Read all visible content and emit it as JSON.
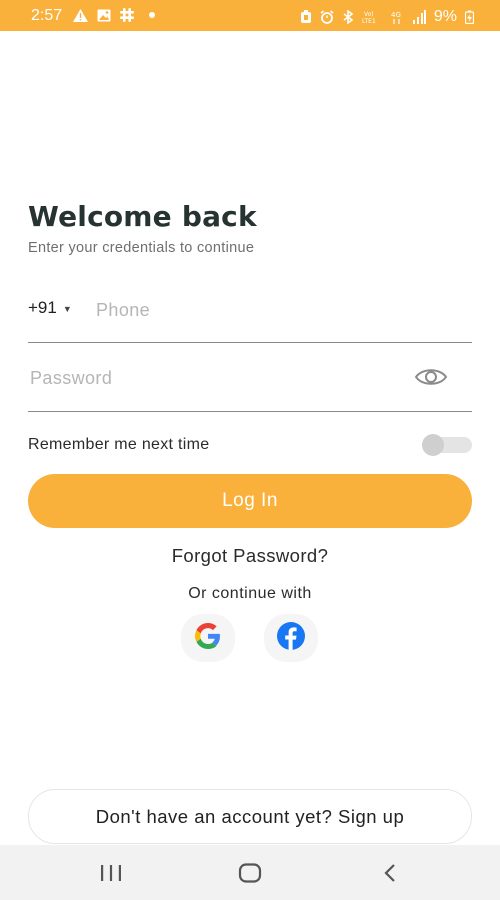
{
  "status_bar": {
    "time": "2:57",
    "battery": "9%",
    "network_label": "4G",
    "icons": [
      "warning-icon",
      "image-icon",
      "slack-icon",
      "dot-icon",
      "battery-saver-icon",
      "alarm-icon",
      "bluetooth-icon",
      "volte-icon",
      "data-icon",
      "signal-icon",
      "battery-charging-icon"
    ],
    "background": "#f9b13c"
  },
  "login": {
    "title": "Welcome back",
    "subtitle": "Enter your credentials to continue",
    "country_code": "+91",
    "phone_placeholder": "Phone",
    "password_placeholder": "Password",
    "remember_label": "Remember me next time",
    "remember_enabled": false,
    "login_button": "Log In",
    "forgot_password": "Forgot Password?",
    "continue_with": "Or continue with",
    "social": [
      "google-icon",
      "facebook-icon"
    ],
    "signup_button": "Don't have an account yet? Sign up"
  },
  "colors": {
    "accent": "#f9b13c",
    "title": "#263331",
    "facebook": "#1877f2"
  },
  "nav_bar": {
    "buttons": [
      "recents-icon",
      "home-icon",
      "back-icon"
    ]
  }
}
